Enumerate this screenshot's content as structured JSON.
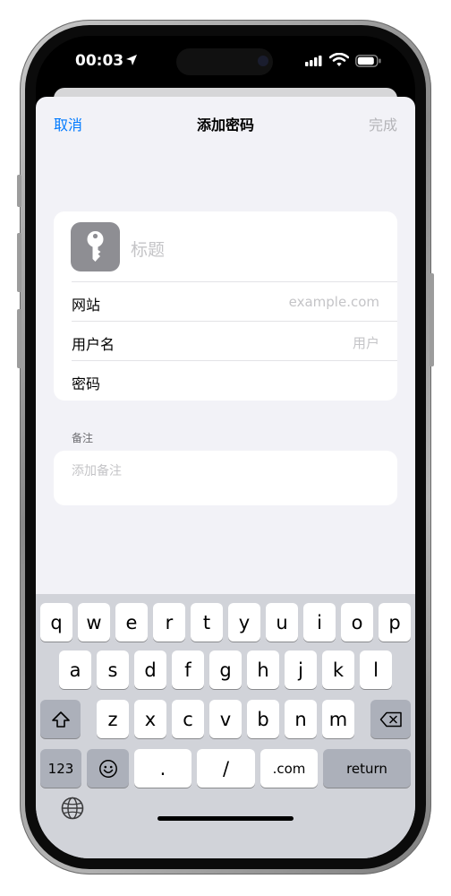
{
  "status_bar": {
    "time": "00:03"
  },
  "nav": {
    "cancel": "取消",
    "title": "添加密码",
    "done": "完成"
  },
  "form": {
    "title_placeholder": "标题",
    "rows": [
      {
        "label": "网站",
        "placeholder": "example.com"
      },
      {
        "label": "用户名",
        "placeholder": "用户"
      },
      {
        "label": "密码",
        "placeholder": ""
      }
    ]
  },
  "notes": {
    "header": "备注",
    "placeholder": "添加备注"
  },
  "keyboard": {
    "row1": [
      "q",
      "w",
      "e",
      "r",
      "t",
      "y",
      "u",
      "i",
      "o",
      "p"
    ],
    "row2": [
      "a",
      "s",
      "d",
      "f",
      "g",
      "h",
      "j",
      "k",
      "l"
    ],
    "row3": [
      "z",
      "x",
      "c",
      "v",
      "b",
      "n",
      "m"
    ],
    "num_key": "123",
    "dot_key": ".",
    "slash_key": "/",
    "com_key": ".com",
    "return_key": "return"
  },
  "colors": {
    "accent": "#007aff",
    "sheet_bg": "#f2f2f7",
    "key_tile": "#8e8e93"
  }
}
